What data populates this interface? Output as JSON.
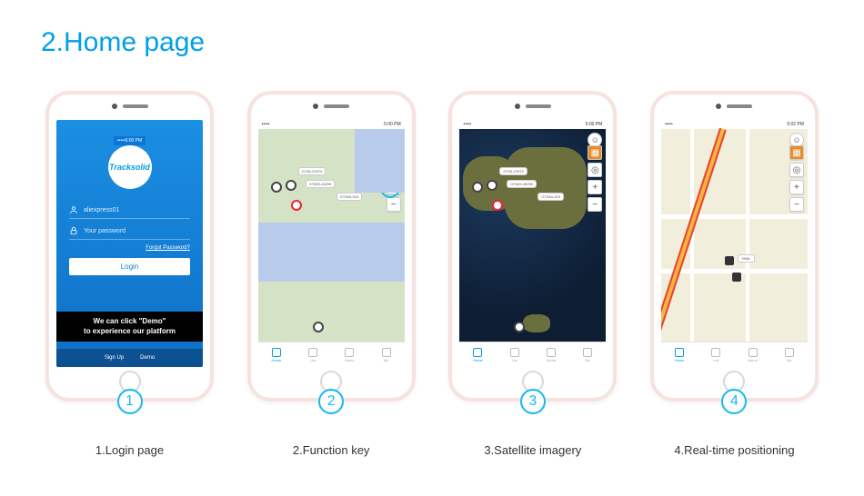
{
  "title": "2.Home page",
  "logo": "Tracksolid",
  "status_time": "5:00 PM",
  "login": {
    "username": "aliexpress01",
    "password_placeholder": "Your password",
    "forgot": "Forgot Password?",
    "login_label": "Login",
    "demo_banner_l1": "We can click \"Demo\"",
    "demo_banner_l2": "to experience our platform",
    "signup": "Sign Up",
    "demo": "Demo"
  },
  "tabs": {
    "home": "Home",
    "list": "List",
    "alerts": "Alerts",
    "me": "Me"
  },
  "items": [
    {
      "badge": "1",
      "caption": "1.Login page"
    },
    {
      "badge": "2",
      "caption": "2.Function key"
    },
    {
      "badge": "3",
      "caption": "3.Satellite imagery"
    },
    {
      "badge": "4",
      "caption": "4.Real-time positioning"
    }
  ],
  "chips": [
    "GT800-45290",
    "GT06-21974",
    "GT05A-515"
  ]
}
